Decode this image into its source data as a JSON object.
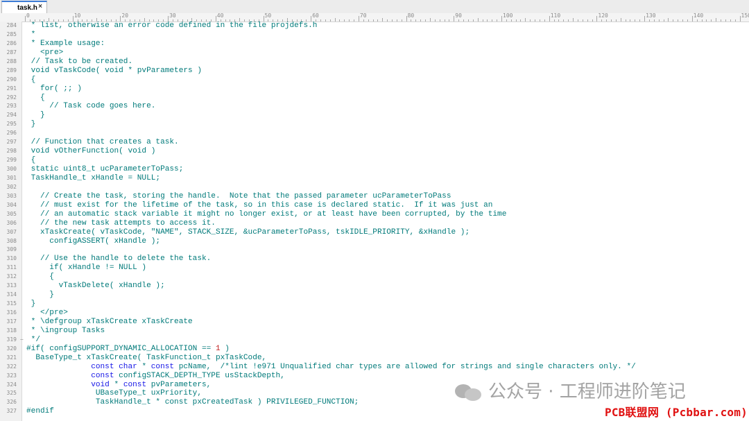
{
  "tab": {
    "title": "task.h",
    "close": "×"
  },
  "ruler": {
    "labels": [
      "0",
      "10",
      "20",
      "30",
      "40",
      "50",
      "60",
      "70",
      "80",
      "90",
      "100",
      "110",
      "120",
      "130",
      "140",
      "150"
    ]
  },
  "lines": [
    {
      "n": "284",
      "t": " * list, otherwise an error code defined in the file projdefs.h"
    },
    {
      "n": "285",
      "t": " *"
    },
    {
      "n": "286",
      "t": " * Example usage:"
    },
    {
      "n": "287",
      "t": "   <pre>"
    },
    {
      "n": "288",
      "t": " // Task to be created."
    },
    {
      "n": "289",
      "t": " void vTaskCode( void * pvParameters )"
    },
    {
      "n": "290",
      "t": " {"
    },
    {
      "n": "291",
      "t": "   for( ;; )"
    },
    {
      "n": "292",
      "t": "   {"
    },
    {
      "n": "293",
      "t": "     // Task code goes here."
    },
    {
      "n": "294",
      "t": "   }"
    },
    {
      "n": "295",
      "t": " }"
    },
    {
      "n": "296",
      "t": ""
    },
    {
      "n": "297",
      "t": " // Function that creates a task."
    },
    {
      "n": "298",
      "t": " void vOtherFunction( void )"
    },
    {
      "n": "299",
      "t": " {"
    },
    {
      "n": "300",
      "t": " static uint8_t ucParameterToPass;"
    },
    {
      "n": "301",
      "t": " TaskHandle_t xHandle = NULL;"
    },
    {
      "n": "302",
      "t": ""
    },
    {
      "n": "303",
      "t": "   // Create the task, storing the handle.  Note that the passed parameter ucParameterToPass"
    },
    {
      "n": "304",
      "t": "   // must exist for the lifetime of the task, so in this case is declared static.  If it was just an"
    },
    {
      "n": "305",
      "t": "   // an automatic stack variable it might no longer exist, or at least have been corrupted, by the time"
    },
    {
      "n": "306",
      "t": "   // the new task attempts to access it."
    },
    {
      "n": "307",
      "t": "   xTaskCreate( vTaskCode, \"NAME\", STACK_SIZE, &ucParameterToPass, tskIDLE_PRIORITY, &xHandle );"
    },
    {
      "n": "308",
      "t": "     configASSERT( xHandle );"
    },
    {
      "n": "309",
      "t": ""
    },
    {
      "n": "310",
      "t": "   // Use the handle to delete the task."
    },
    {
      "n": "311",
      "t": "     if( xHandle != NULL )"
    },
    {
      "n": "312",
      "t": "     {"
    },
    {
      "n": "313",
      "t": "       vTaskDelete( xHandle );"
    },
    {
      "n": "314",
      "t": "     }"
    },
    {
      "n": "315",
      "t": " }"
    },
    {
      "n": "316",
      "t": "   </pre>"
    },
    {
      "n": "317",
      "t": " * \\defgroup xTaskCreate xTaskCreate"
    },
    {
      "n": "318",
      "t": " * \\ingroup Tasks"
    },
    {
      "n": "319",
      "t": " */"
    },
    {
      "n": "320",
      "pre": "#if",
      "t": "( configSUPPORT_DYNAMIC_ALLOCATION == ",
      "red": "1",
      "post": " )"
    },
    {
      "n": "321",
      "t": "  BaseType_t xTaskCreate( TaskFunction_t pxTaskCode,"
    },
    {
      "n": "322",
      "pad": "              ",
      "kw": "const char",
      "mid": " * ",
      "kw2": "const",
      "t": " pcName,  /*lint !e971 Unqualified char types are allowed for strings and single characters only. */"
    },
    {
      "n": "323",
      "pad": "              ",
      "kw": "const",
      "t": " configSTACK_DEPTH_TYPE usStackDepth,"
    },
    {
      "n": "324",
      "pad": "              ",
      "kw": "void",
      "mid": " * ",
      "kw2": "const",
      "t": " pvParameters,"
    },
    {
      "n": "325",
      "t": "               UBaseType_t uxPriority,"
    },
    {
      "n": "326",
      "t": "               TaskHandle_t * const pxCreatedTask ) PRIVILEGED_FUNCTION;"
    },
    {
      "n": "327",
      "pre": "#endif",
      "t": ""
    }
  ],
  "fold_markers": {
    "319": "−"
  },
  "watermark": {
    "text": "公众号 · 工程师进阶笔记"
  },
  "brand": {
    "text": "PCB联盟网 (Pcbbar.com)"
  },
  "colors": {
    "code": "#007a7a",
    "keyword": "#1515e6",
    "preprocessor": "#7a0fb5",
    "number": "#c01d1d",
    "brand": "#e01010"
  }
}
